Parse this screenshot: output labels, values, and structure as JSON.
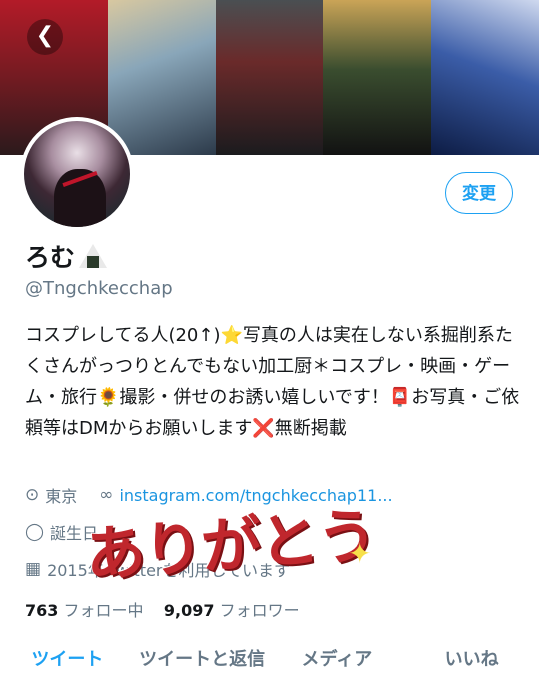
{
  "header": {
    "back_icon": "chevron-left-icon",
    "back_glyph": "❮"
  },
  "profile": {
    "name": "ろむ",
    "name_emoji_icon": "rice-ball-icon",
    "handle": "@Tngchkecchap",
    "edit_label": "変更",
    "bio": "コスプレしてる人(20↑)⭐写真の人は実在しない系掘削系たくさんがっつりとんでもない加工厨＊コスプレ・映画・ゲーム・旅行🌻撮影・併せのお誘い嬉しいです！📮お写真・ご依頼等はDMからお願いします❌無断掲載",
    "location": "東京",
    "website": "instagram.com/tngchkecchap11...",
    "birthday": "誕生日",
    "joined": "2015年  Twitterを利用しています"
  },
  "stats": {
    "following_count": "763",
    "following_label": "フォロー中",
    "followers_count": "9,097",
    "followers_label": "フォロワー"
  },
  "tabs": [
    {
      "label": "ツイート",
      "active": true
    },
    {
      "label": "ツイートと返信",
      "active": false
    },
    {
      "label": "メディア",
      "active": false
    },
    {
      "label": "いいね",
      "active": false
    }
  ],
  "overlay": {
    "text": "ありがとう",
    "sparkle_glyph": "✦"
  },
  "colors": {
    "accent": "#1da1f2",
    "secondary_text": "#657786",
    "overlay_red": "#c0272d"
  }
}
